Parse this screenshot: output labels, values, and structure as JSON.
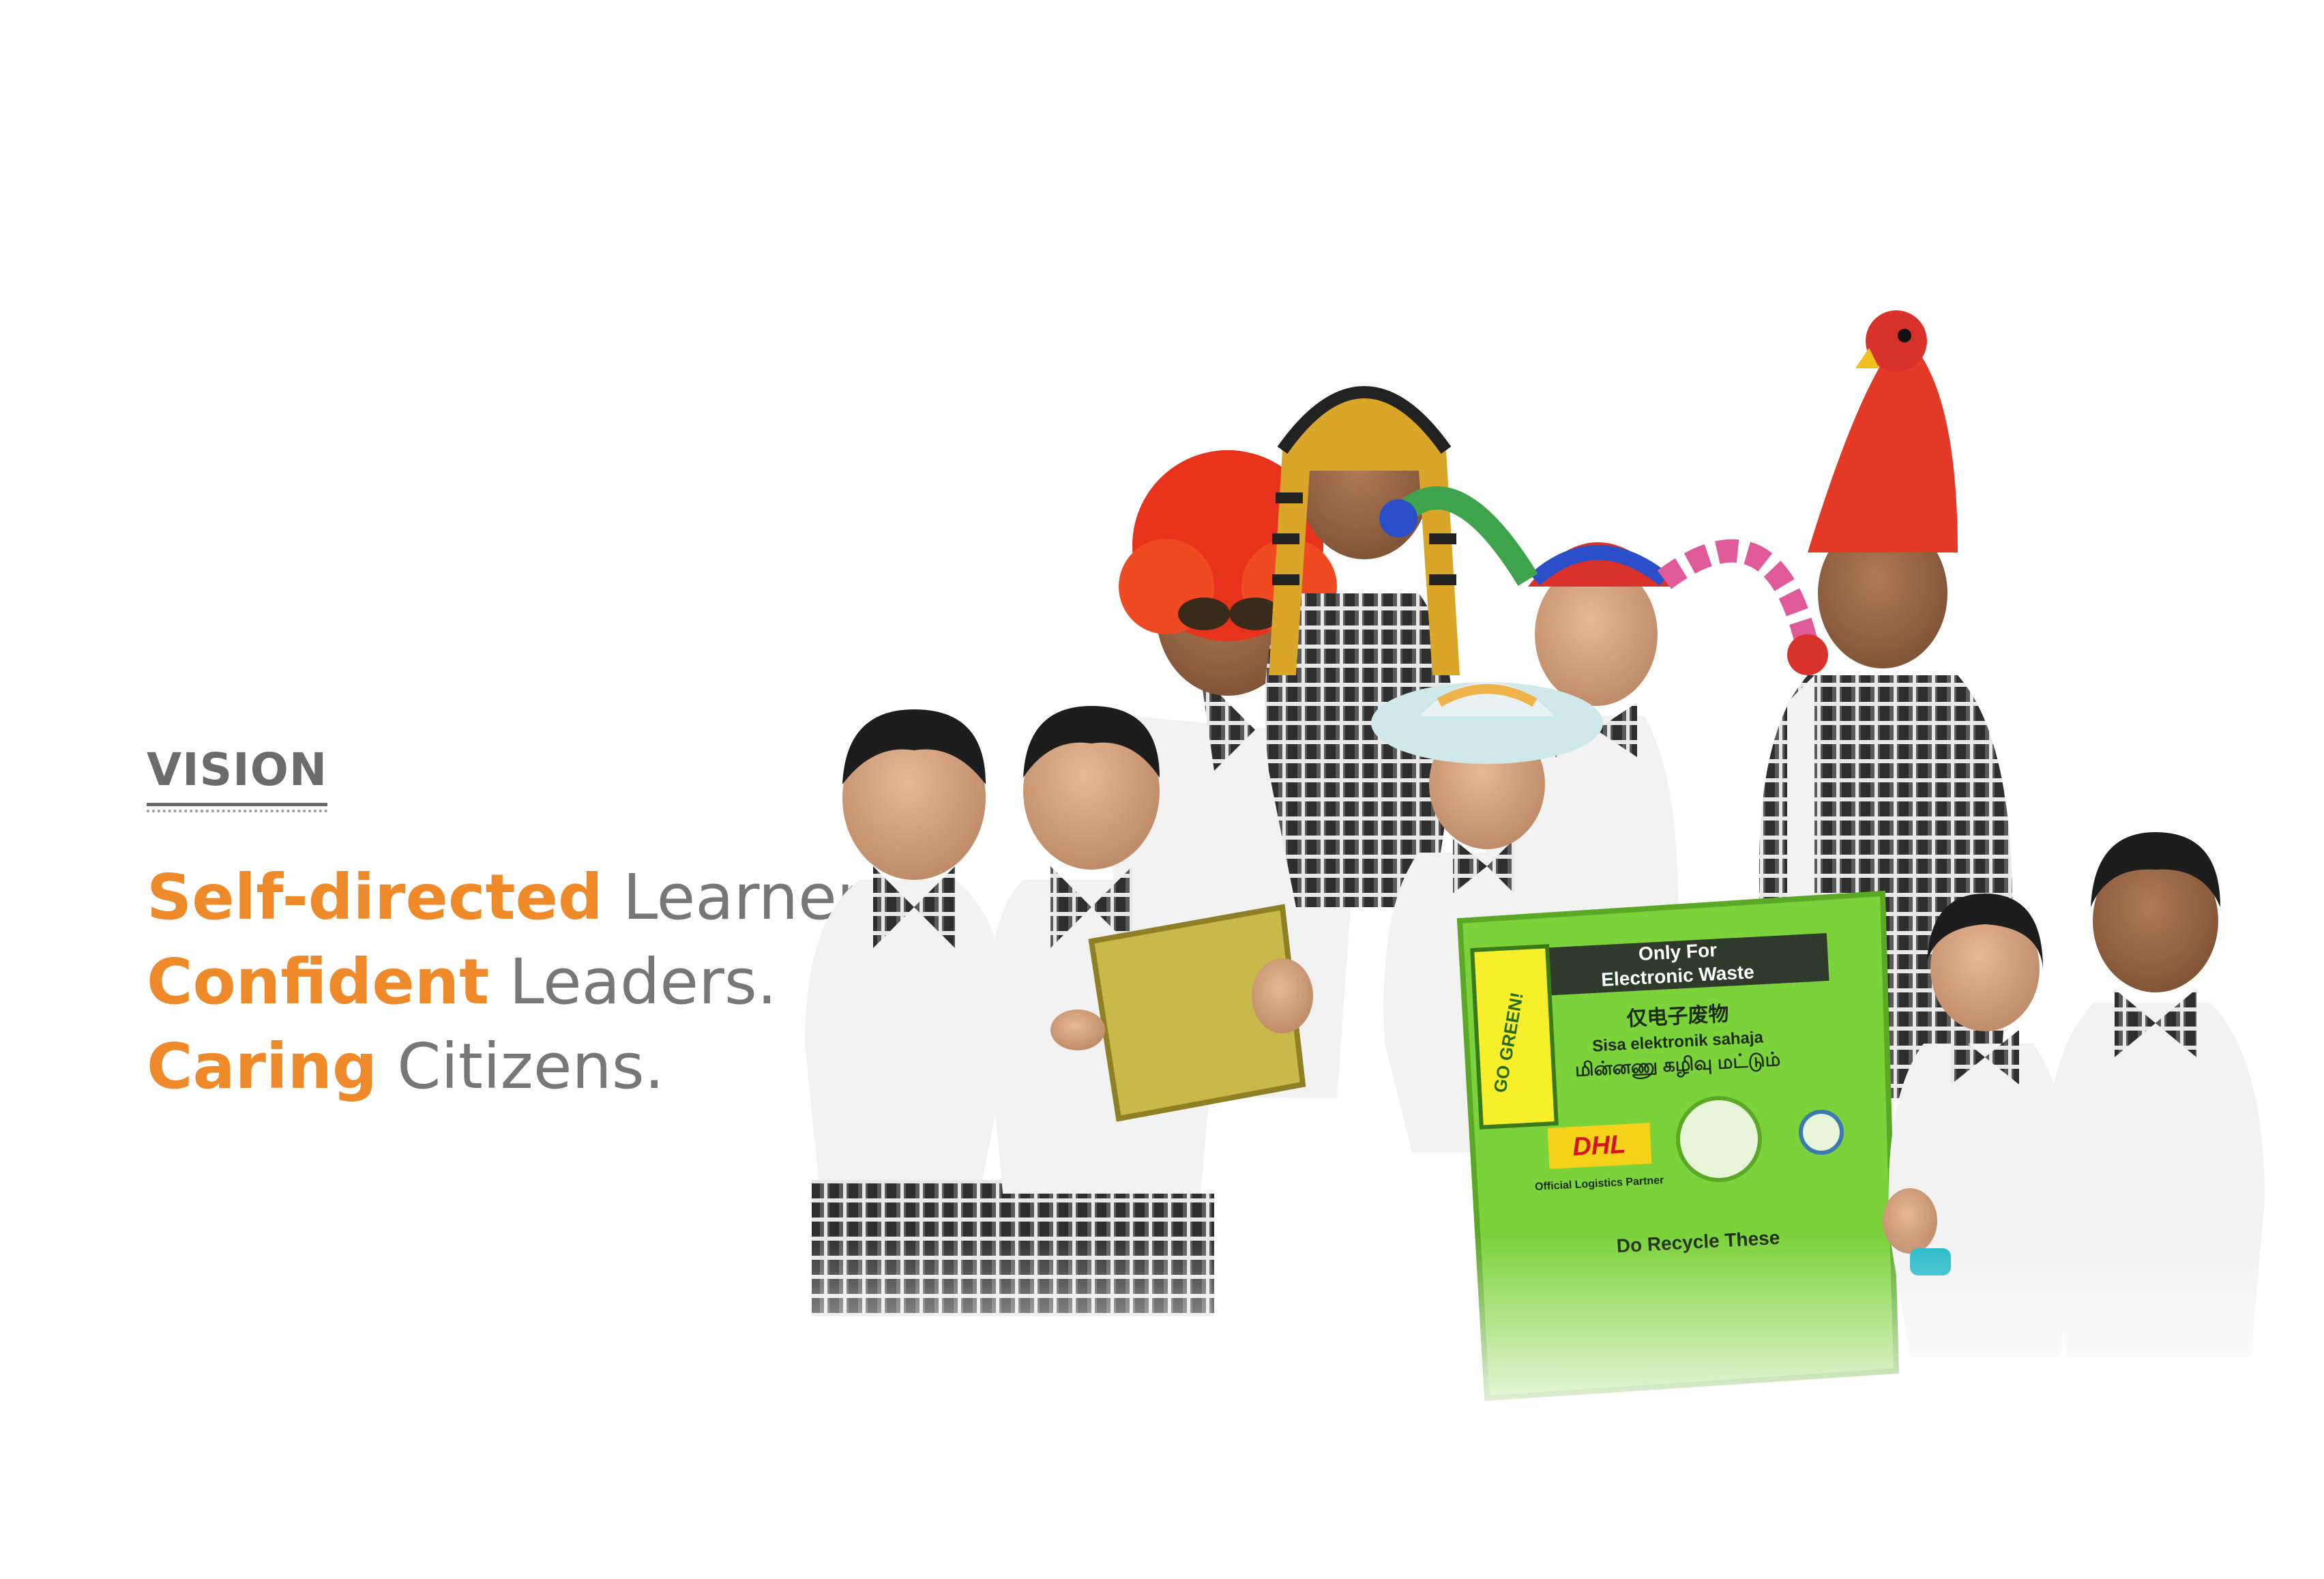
{
  "vision": {
    "heading": "VISION",
    "lines": [
      {
        "accent": "Self-directed",
        "rest": " Learners."
      },
      {
        "accent": "Confident",
        "rest": " Leaders."
      },
      {
        "accent": "Caring",
        "rest": " Citizens."
      }
    ]
  },
  "colors": {
    "accent": "#ee8a2a",
    "text_gray": "#777777",
    "heading_gray": "#6b6b6b",
    "uniform_white": "#f4f4f4",
    "uniform_check": "#3a3a3a",
    "bin_green": "#7bd23a"
  },
  "photo": {
    "description_icon": "students-group-photo",
    "bin": {
      "slot_label_1": "Only For",
      "slot_label_2": "Electronic Waste",
      "chinese_label": "仅电子废物",
      "malay_label": "Sisa elektronik sahaja",
      "tamil_label": "மின்னணு கழிவு மட்டும்",
      "go_green": "GO GREEN!",
      "dhl": "DHL",
      "partner_label": "Official Logistics Partner",
      "recycle_label": "Do Recycle These"
    }
  }
}
